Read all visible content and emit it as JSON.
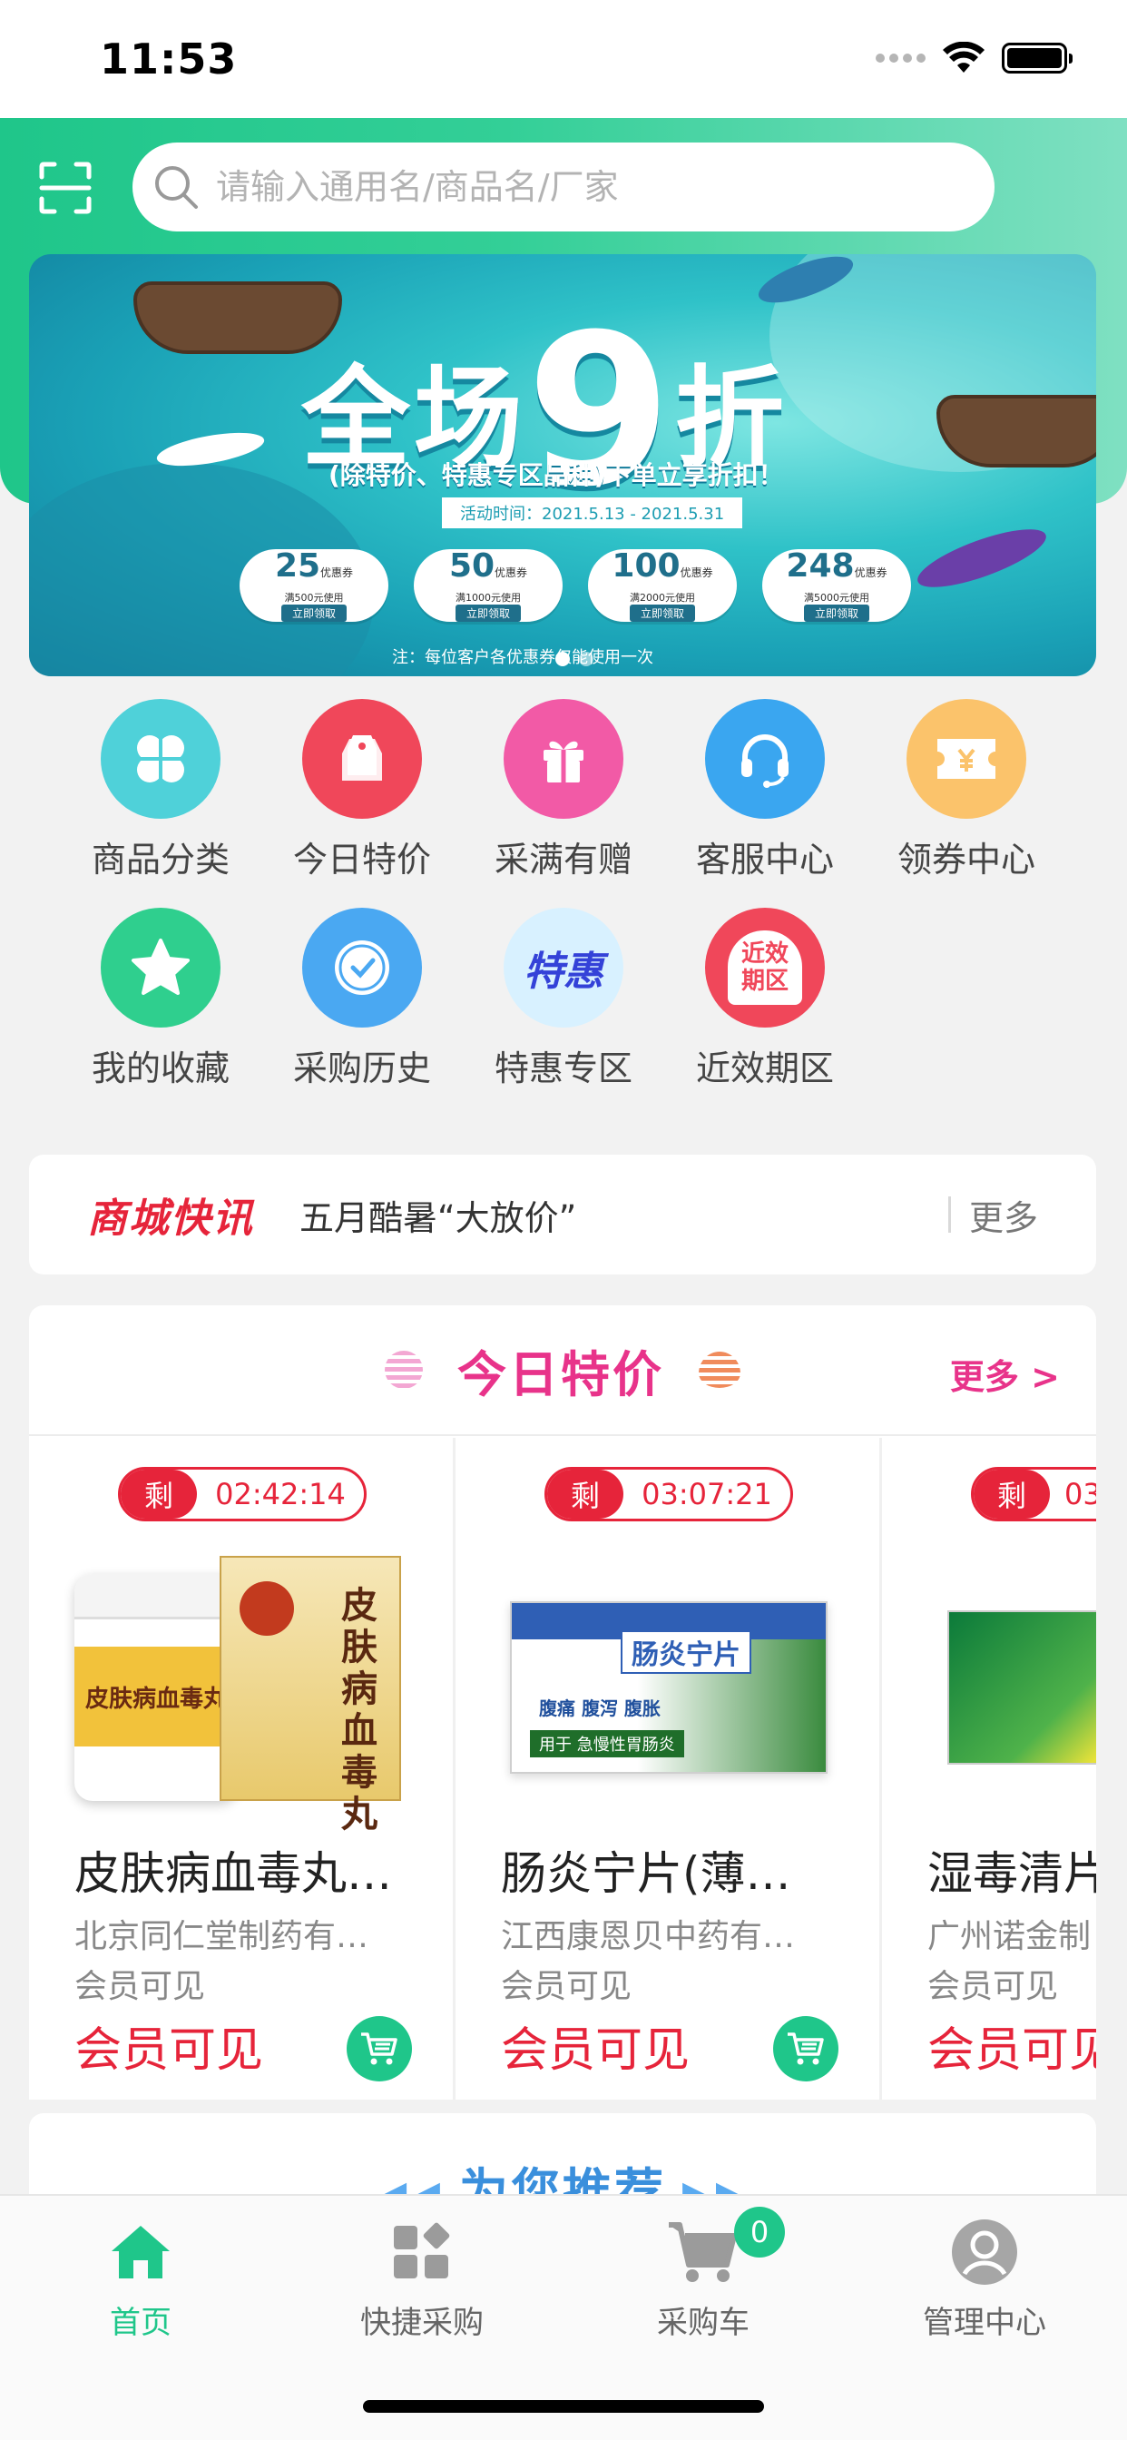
{
  "status_bar": {
    "time": "11:53"
  },
  "header": {
    "search_placeholder": "请输入通用名/商品名/厂家"
  },
  "banner": {
    "headline_prefix": "全场",
    "headline_number": "9",
    "headline_suffix": "折",
    "subtitle": "(除特价、特惠专区品种)下单立享折扣！",
    "date": "活动时间：2021.5.13 - 2021.5.31",
    "coupons": [
      {
        "amount": "25",
        "label": "优惠券",
        "cond": "满500元使用",
        "action": "立即领取"
      },
      {
        "amount": "50",
        "label": "优惠券",
        "cond": "满1000元使用",
        "action": "立即领取"
      },
      {
        "amount": "100",
        "label": "优惠券",
        "cond": "满2000元使用",
        "action": "立即领取"
      },
      {
        "amount": "248",
        "label": "优惠券",
        "cond": "满5000元使用",
        "action": "立即领取"
      }
    ],
    "note": "注：每位客户各优惠券仅能使用一次",
    "colors": {
      "sea": "#2fc2c8",
      "deep": "#0f7a99"
    }
  },
  "menu": [
    {
      "label": "商品分类",
      "icon": "grid-clover-icon",
      "color": "#4fd1d9"
    },
    {
      "label": "今日特价",
      "icon": "price-tag-icon",
      "color": "#f0475a"
    },
    {
      "label": "采满有赠",
      "icon": "gift-icon",
      "color": "#f25aa6"
    },
    {
      "label": "客服中心",
      "icon": "headset-icon",
      "color": "#3aa6f0"
    },
    {
      "label": "领券中心",
      "icon": "coupon-icon",
      "color": "#fbc36b"
    },
    {
      "label": "我的收藏",
      "icon": "star-icon",
      "color": "#2fcf8e"
    },
    {
      "label": "采购历史",
      "icon": "clock-icon",
      "color": "#4aa8f2"
    },
    {
      "label": "特惠专区",
      "icon": "special-offer-icon",
      "color": "#5b6cf0",
      "icon_text": "特惠"
    },
    {
      "label": "近效期区",
      "icon": "bell-icon",
      "color": "#f0475a",
      "icon_text": "近效期区"
    }
  ],
  "news": {
    "logo": "商城快讯",
    "text": "五月酷暑“大放价”",
    "more": "更多"
  },
  "deals": {
    "title": "今日特价",
    "more": "更多 >",
    "remain_label": "剩",
    "items": [
      {
        "timer": "02:42:14",
        "name": "皮肤病血毒丸…",
        "maker": "北京同仁堂制药有…",
        "member": "会员可见",
        "price": "会员可见",
        "box_text": "皮肤病血毒丸"
      },
      {
        "timer": "03:07:21",
        "name": "肠炎宁片(薄…",
        "maker": "江西康恩贝中药有…",
        "member": "会员可见",
        "price": "会员可见",
        "box_text": "肠炎宁片",
        "box_sub": "腹痛 腹泻 腹胀",
        "box_use": "用于 急慢性胃肠炎"
      },
      {
        "timer": "03:",
        "name": "湿毒清片",
        "maker": "广州诺金制",
        "member": "会员可见",
        "price": "会员可见"
      }
    ]
  },
  "recommend": {
    "title": "为您推荐",
    "left_arrows": "◀◀",
    "right_arrows": "▶▶"
  },
  "tabbar": {
    "tabs": [
      {
        "label": "首页",
        "icon": "home-icon"
      },
      {
        "label": "快捷采购",
        "icon": "quick-buy-icon"
      },
      {
        "label": "采购车",
        "icon": "cart-icon",
        "badge": "0"
      },
      {
        "label": "管理中心",
        "icon": "user-icon"
      }
    ],
    "active_color": "#1fc68a"
  }
}
